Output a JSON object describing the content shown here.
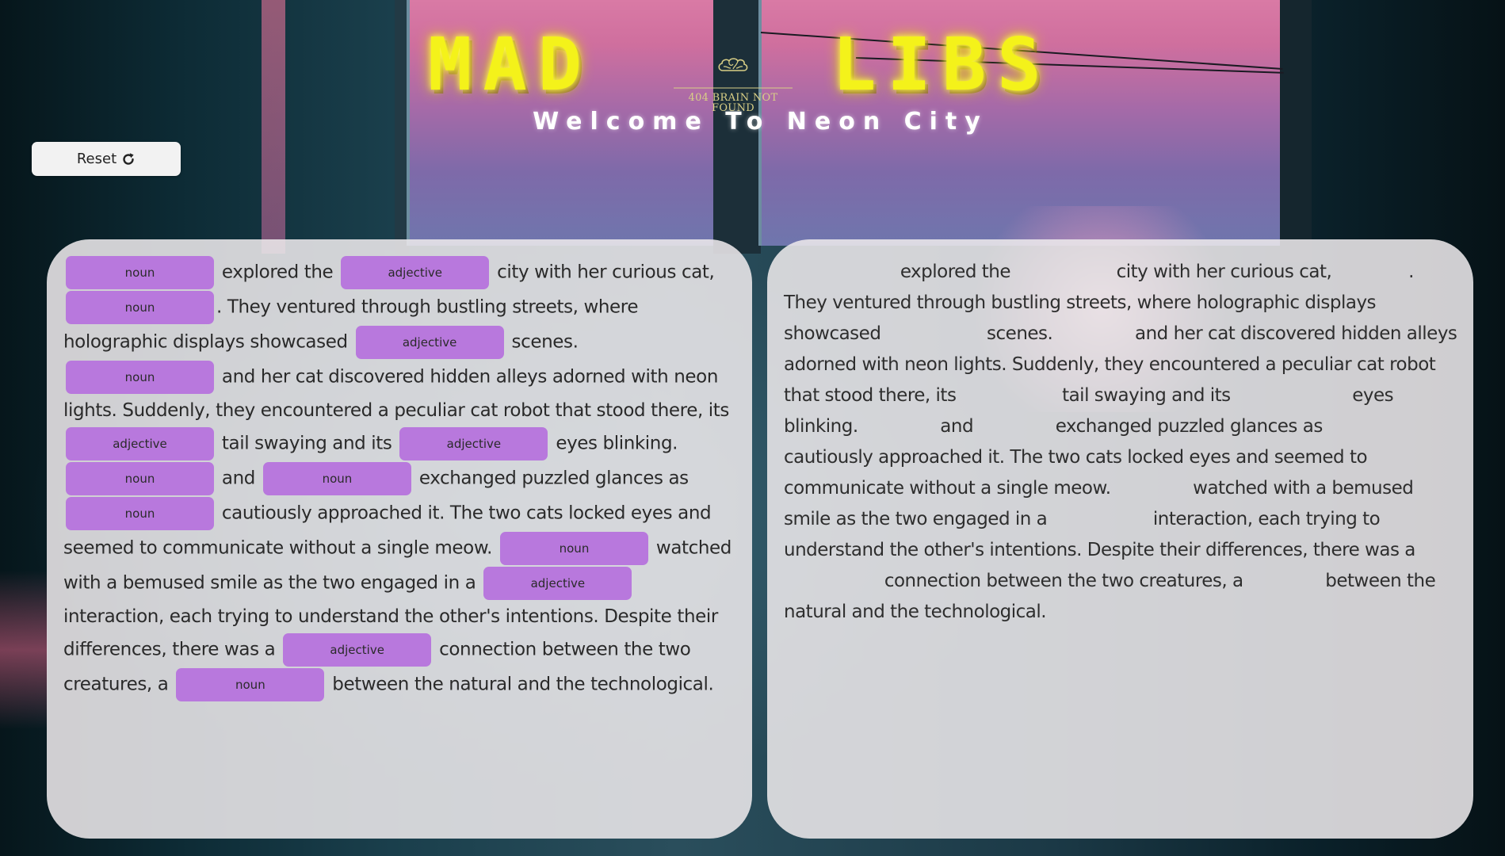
{
  "header": {
    "title_left": "MAD",
    "title_right": "LIBS",
    "logo_text": "404 BRAIN NOT FOUND",
    "subtitle": "Welcome To Neon City"
  },
  "toolbar": {
    "reset_label": "Reset"
  },
  "icons": {
    "reset": "refresh-icon",
    "logo": "brain-icon"
  },
  "colors": {
    "title": "#f4f21a",
    "blank": "#b878dd",
    "panel": "#ece8ea"
  },
  "blanks": [
    {
      "placeholder": "noun",
      "value": ""
    },
    {
      "placeholder": "adjective",
      "value": ""
    },
    {
      "placeholder": "noun",
      "value": ""
    },
    {
      "placeholder": "adjective",
      "value": ""
    },
    {
      "placeholder": "noun",
      "value": ""
    },
    {
      "placeholder": "adjective",
      "value": ""
    },
    {
      "placeholder": "adjective",
      "value": ""
    },
    {
      "placeholder": "noun",
      "value": ""
    },
    {
      "placeholder": "noun",
      "value": ""
    },
    {
      "placeholder": "noun",
      "value": ""
    },
    {
      "placeholder": "noun",
      "value": ""
    },
    {
      "placeholder": "adjective",
      "value": ""
    },
    {
      "placeholder": "adjective",
      "value": ""
    },
    {
      "placeholder": "noun",
      "value": ""
    }
  ],
  "story": {
    "s1": "explored the",
    "s2": "city with her curious cat,",
    "s3": ". They ventured through bustling streets, where holographic displays showcased",
    "s4": "scenes.",
    "s5": "and her cat discovered hidden alleys adorned with neon lights. Suddenly, they encountered a peculiar cat robot that stood there, its",
    "s6": "tail swaying and its",
    "s7": "eyes blinking.",
    "s8": "and",
    "s9": "exchanged puzzled glances as",
    "s10": "cautiously approached it. The two cats locked eyes and seemed to communicate without a single meow.",
    "s11": "watched with a bemused smile as the two engaged in a",
    "s12": "interaction, each trying to understand the other's intentions. Despite their differences, there was a",
    "s13": "connection between the two creatures, a",
    "s14": "between the natural and the technological."
  }
}
